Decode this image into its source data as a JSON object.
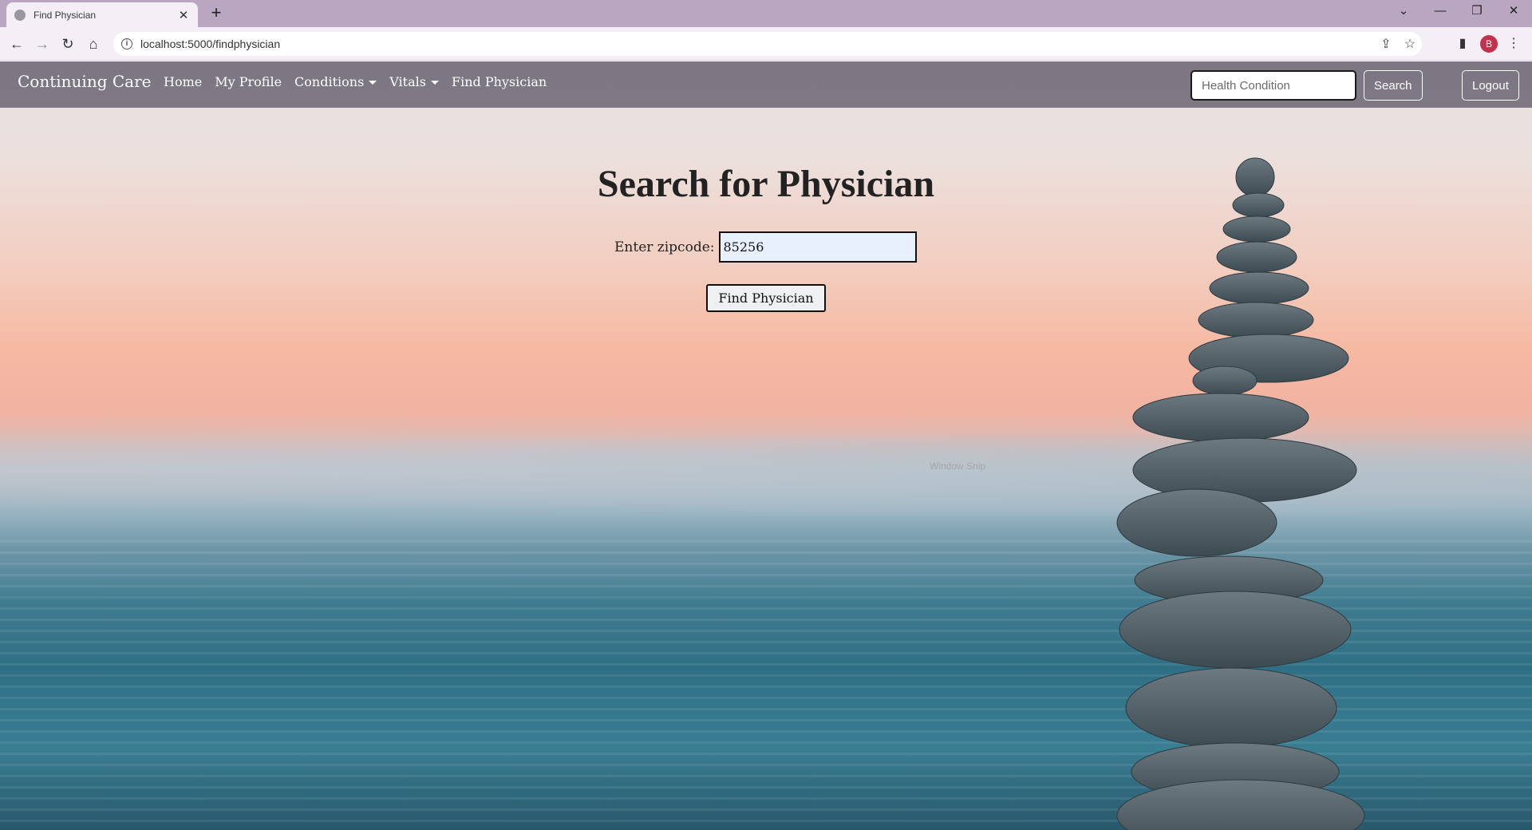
{
  "browser": {
    "tab_title": "Find Physician",
    "tab_close": "✕",
    "new_tab": "+",
    "url": "localhost:5000/findphysician",
    "profile_initial": "B",
    "window_controls": [
      "⌄",
      "—",
      "❐",
      "✕"
    ]
  },
  "navbar": {
    "brand": "Continuing Care",
    "links": [
      {
        "label": "Home",
        "dropdown": false
      },
      {
        "label": "My Profile",
        "dropdown": false
      },
      {
        "label": "Conditions",
        "dropdown": true
      },
      {
        "label": "Vitals",
        "dropdown": true
      },
      {
        "label": "Find Physician",
        "dropdown": false
      }
    ],
    "search_placeholder": "Health Condition",
    "search_button": "Search",
    "logout_button": "Logout"
  },
  "page": {
    "title": "Search for Physician",
    "zip_label": "Enter zipcode:",
    "zip_value": "85256",
    "find_button": "Find Physician"
  },
  "overlay": {
    "watermark_text": "Window Snip"
  },
  "colors": {
    "tabstrip": "#b9a6c0",
    "navbar": "#6e6876",
    "profile": "#c4314b",
    "input_fill": "#e8f0fe"
  }
}
